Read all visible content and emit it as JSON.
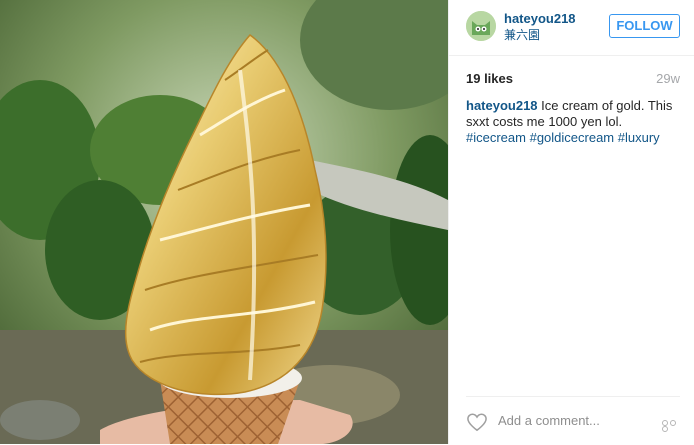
{
  "post": {
    "username": "hateyou218",
    "location": "兼六園",
    "follow_label": "FOLLOW",
    "likes": "19 likes",
    "age": "29w",
    "caption_user": "hateyou218",
    "caption_text": " Ice cream of gold. This sxxt costs me 1000 yen lol.",
    "hashtags": [
      "#icecream",
      "#goldicecream",
      "#luxury"
    ],
    "comment_placeholder": "Add a comment..."
  },
  "icons": {
    "heart": "heart-icon",
    "more": "more-options-icon",
    "avatar": "avatar"
  },
  "colors": {
    "link": "#125688",
    "follow": "#3897f0",
    "muted": "#a5a7aa"
  }
}
